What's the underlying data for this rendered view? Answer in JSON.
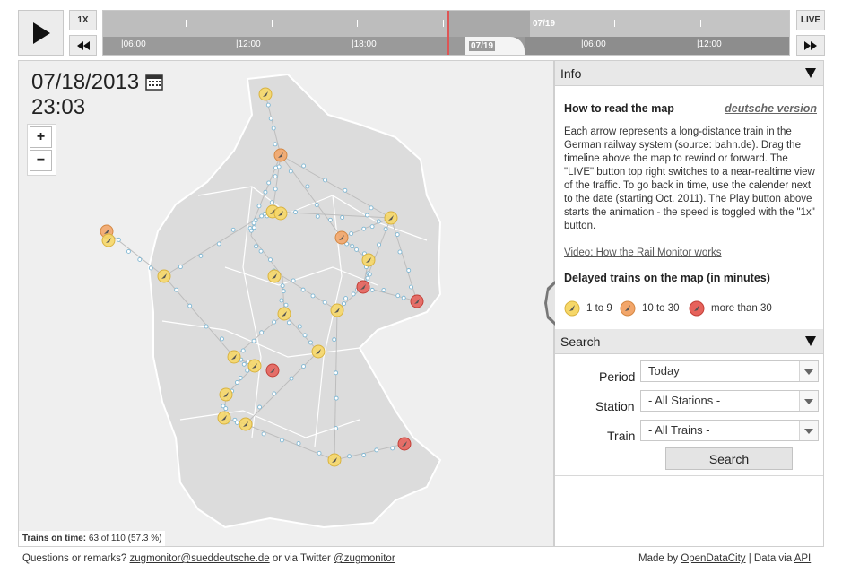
{
  "controls": {
    "speed_label": "1X",
    "live_label": "LIVE"
  },
  "timeline": {
    "top_date": "07/19",
    "bottom_date": "07/19",
    "labels": [
      "06:00",
      "12:00",
      "18:00",
      "06:00",
      "12:00"
    ]
  },
  "map": {
    "date": "07/18/2013",
    "time": "23:03",
    "zoom_in": "+",
    "zoom_out": "−",
    "on_time_label": "Trains on time:",
    "on_time_value": "63 of 110 (57.3 %)"
  },
  "info": {
    "header": "Info",
    "how_title": "How to read the map",
    "german_link": "deutsche version",
    "paragraph": "Each arrow represents a long-distance train in the German railway system (source: bahn.de). Drag the timeline above the map to rewind or forward. The \"LIVE\" button top right switches to a near-realtime view of the traffic. To go back in time, use the calender next to the date (starting Oct. 2011). The Play button above starts the animation - the speed is toggled with the \"1x\" button.",
    "video_link": "Video: How the Rail Monitor works",
    "delay_title": "Delayed trains on the map (in minutes)",
    "legend": [
      "1 to 9",
      "10 to 30",
      "more than 30"
    ],
    "legend_colors": [
      "#f6d768",
      "#f2a66a",
      "#e6625b"
    ]
  },
  "search": {
    "header": "Search",
    "period_label": "Period",
    "period_value": "Today",
    "station_label": "Station",
    "station_value": "- All Stations -",
    "train_label": "Train",
    "train_value": "- All Trains -",
    "button": "Search"
  },
  "footer": {
    "question": "Questions or remarks?",
    "email": "zugmonitor@sueddeutsche.de",
    "or_twitter": "or via Twitter",
    "twitter": "@zugmonitor",
    "made_by": "Made by",
    "odc": "OpenDataCity",
    "data_via": "| Data via",
    "api": "API"
  }
}
